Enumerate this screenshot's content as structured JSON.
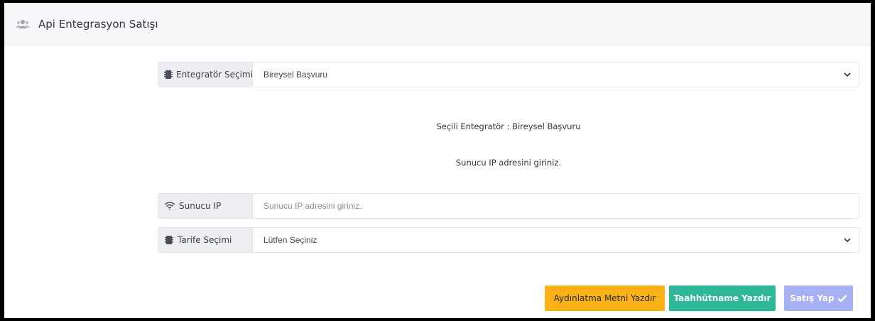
{
  "header": {
    "title": "Api Entegrasyon Satışı",
    "icon": "users-icon"
  },
  "integrator": {
    "label": "Entegratör Seçimi",
    "icon": "sim-card-icon",
    "selected": "Bireysel Başvuru"
  },
  "messages": {
    "selected_integrator": "Seçili Entegratör : Bireysel Başvuru",
    "ip_prompt": "Sunucu IP adresini giriniz."
  },
  "server_ip": {
    "label": "Sunucu IP",
    "icon": "wifi-icon",
    "value": "",
    "placeholder": "Sunucu IP adresini giriniz."
  },
  "tariff": {
    "label": "Tarife Seçimi",
    "icon": "sim-card-icon",
    "selected": "Lütfen Seçiniz"
  },
  "actions": {
    "print_disclosure": "Aydınlatma Metni Yazdır",
    "print_commitment": "Taahhütname Yazdır",
    "make_sale": "Satış Yap",
    "make_sale_icon": "check-icon"
  },
  "colors": {
    "yellow": "#f9b115",
    "green": "#2eb89a",
    "purple": "#a7b0f3"
  }
}
